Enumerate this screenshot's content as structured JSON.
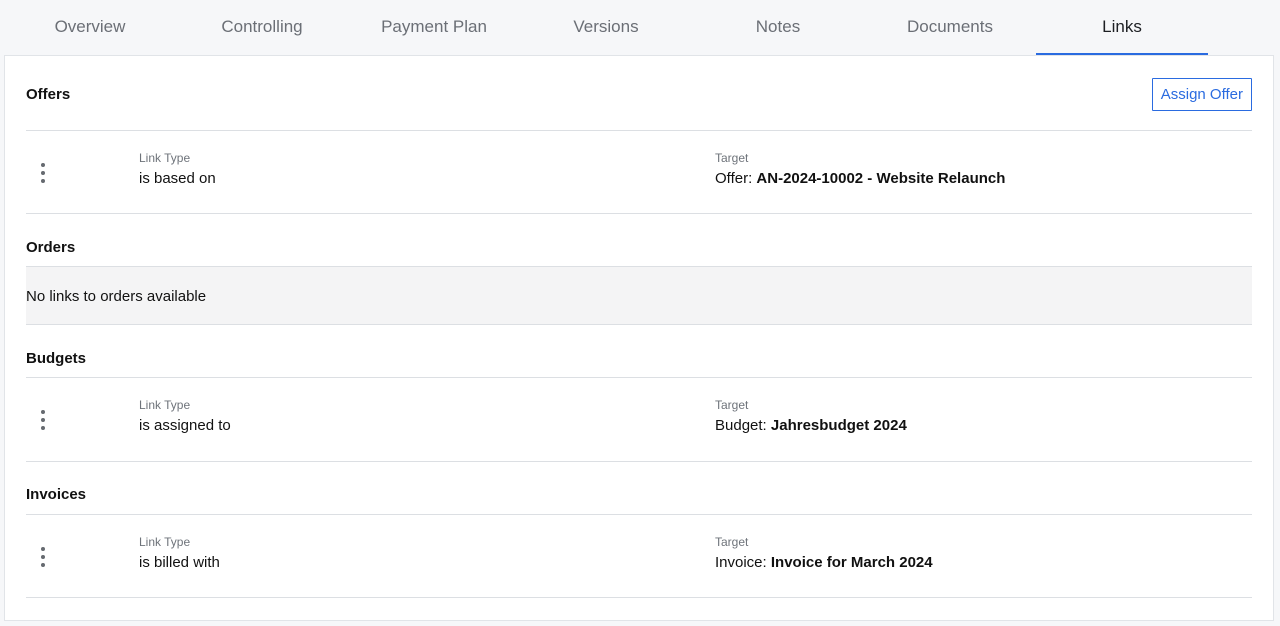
{
  "tabs": [
    {
      "label": "Overview",
      "active": false
    },
    {
      "label": "Controlling",
      "active": false
    },
    {
      "label": "Payment Plan",
      "active": false
    },
    {
      "label": "Versions",
      "active": false
    },
    {
      "label": "Notes",
      "active": false
    },
    {
      "label": "Documents",
      "active": false
    },
    {
      "label": "Links",
      "active": true
    }
  ],
  "accent_color": "#2a6be0",
  "sections": {
    "offers": {
      "title": "Offers",
      "action_label": "Assign Offer",
      "rows": [
        {
          "link_type_label": "Link Type",
          "link_type": "is based on",
          "target_label": "Target",
          "target_prefix": "Offer: ",
          "target_name": "AN-2024-10002 - Website Relaunch"
        }
      ]
    },
    "orders": {
      "title": "Orders",
      "empty_text": "No links to orders available"
    },
    "budgets": {
      "title": "Budgets",
      "rows": [
        {
          "link_type_label": "Link Type",
          "link_type": "is assigned to",
          "target_label": "Target",
          "target_prefix": "Budget: ",
          "target_name": "Jahresbudget 2024"
        }
      ]
    },
    "invoices": {
      "title": "Invoices",
      "rows": [
        {
          "link_type_label": "Link Type",
          "link_type": "is billed with",
          "target_label": "Target",
          "target_prefix": "Invoice: ",
          "target_name": "Invoice for March 2024"
        }
      ]
    }
  }
}
